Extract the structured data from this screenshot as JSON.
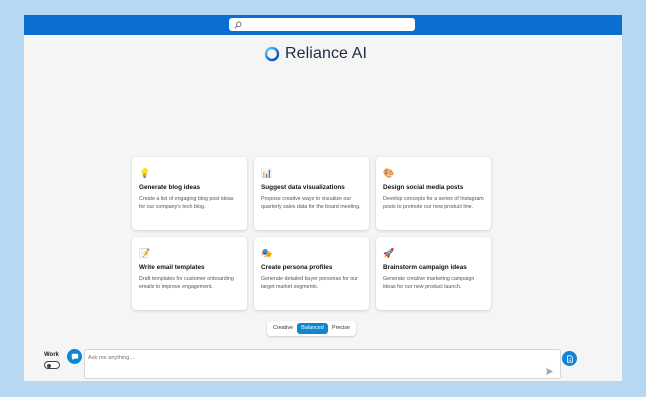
{
  "app": {
    "title": "Reliance AI"
  },
  "search": {
    "placeholder": ""
  },
  "cards": [
    {
      "icon": "💡",
      "icon_name": "lightbulb-icon",
      "title": "Generate blog ideas",
      "description": "Create a list of engaging blog post ideas for our company's tech blog."
    },
    {
      "icon": "📊",
      "icon_name": "bar-chart-icon",
      "title": "Suggest data visualizations",
      "description": "Propose creative ways to visualize our quarterly sales data for the board meeting."
    },
    {
      "icon": "🎨",
      "icon_name": "palette-icon",
      "title": "Design social media posts",
      "description": "Develop concepts for a series of Instagram posts to promote our new product line."
    },
    {
      "icon": "📝",
      "icon_name": "memo-icon",
      "title": "Write email templates",
      "description": "Draft templates for customer onboarding emails to improve engagement."
    },
    {
      "icon": "🎭",
      "icon_name": "theater-masks-icon",
      "title": "Create persona profiles",
      "description": "Generate detailed buyer personas for our target market segments."
    },
    {
      "icon": "🚀",
      "icon_name": "rocket-icon",
      "title": "Brainstorm campaign ideas",
      "description": "Generate creative marketing campaign ideas for our new product launch."
    }
  ],
  "modes": {
    "options": [
      "Creative",
      "Balanced",
      "Precise"
    ],
    "selected": "Balanced"
  },
  "work": {
    "label": "Work",
    "enabled": false
  },
  "chat": {
    "placeholder": "Ask me anything..."
  },
  "colors": {
    "accent": "#0e86d4",
    "topbar": "#0b6fd1",
    "background": "#b7d8f2"
  }
}
